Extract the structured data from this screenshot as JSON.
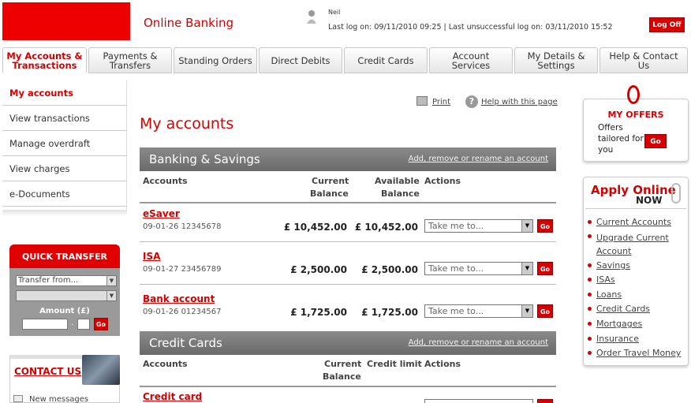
{
  "header": {
    "app_title": "Online Banking",
    "user_name": "Neil",
    "last_logon": "Last log on: 09/11/2010 09:25  |  Last unsuccessful log on: 03/11/2010 15:52",
    "logoff_label": "Log Off",
    "brand_color": "#ee0000"
  },
  "tabs": [
    {
      "label": "My Accounts & Transactions",
      "active": true
    },
    {
      "label": "Payments & Transfers"
    },
    {
      "label": "Standing Orders"
    },
    {
      "label": "Direct Debits"
    },
    {
      "label": "Credit Cards"
    },
    {
      "label": "Account Services"
    },
    {
      "label": "My Details & Settings"
    },
    {
      "label": "Help & Contact Us"
    }
  ],
  "leftnav": {
    "items": [
      {
        "label": "My accounts",
        "active": true
      },
      {
        "label": "View transactions"
      },
      {
        "label": "Manage overdraft"
      },
      {
        "label": "View charges"
      },
      {
        "label": "e-Documents"
      }
    ]
  },
  "quick_transfer": {
    "title": "QUICK TRANSFER",
    "from_placeholder": "Transfer from...",
    "to_value": "",
    "amount_label": "Amount (£)",
    "dot": ".",
    "go": "Go"
  },
  "contact": {
    "label": "CONTACT US",
    "new_messages": "New messages"
  },
  "main": {
    "print": "Print",
    "help": "Help with this page",
    "title": "My accounts",
    "banking": {
      "heading": "Banking & Savings",
      "link": "Add, remove or rename an account",
      "col_accounts": "Accounts",
      "col_current": "Current",
      "col_current2": "Balance",
      "col_available": "Available",
      "col_available2": "Balance",
      "col_actions": "Actions",
      "rows": [
        {
          "name": "eSaver",
          "number": "09-01-26 12345678",
          "current": "£ 10,452.00",
          "available": "£ 10,452.00",
          "action": "Take me to...",
          "go": "Go"
        },
        {
          "name": "ISA",
          "number": "09-01-27 23456789",
          "current": "£ 2,500.00",
          "available": "£ 2,500.00",
          "action": "Take me to...",
          "go": "Go"
        },
        {
          "name": "Bank account",
          "number": "09-01-26 01234567",
          "current": "£ 1,725.00",
          "available": "£ 1,725.00",
          "action": "Take me to...",
          "go": "Go"
        }
      ]
    },
    "credit": {
      "heading": "Credit Cards",
      "link": "Add, remove or rename an account",
      "col_accounts": "Accounts",
      "col_current": "Current",
      "col_current2": "Balance",
      "col_limit": "Credit limit",
      "col_actions": "Actions",
      "rows": [
        {
          "name": "Credit card"
        }
      ]
    }
  },
  "offers": {
    "title": "MY OFFERS",
    "text": "Offers tailored for you",
    "go": "Go"
  },
  "apply": {
    "title": "Apply Online",
    "now": "NOW",
    "items": [
      "Current Accounts",
      "Upgrade Current Account",
      "Savings",
      "ISAs",
      "Loans",
      "Credit Cards",
      "Mortgages",
      "Insurance",
      "Order Travel Money"
    ]
  }
}
